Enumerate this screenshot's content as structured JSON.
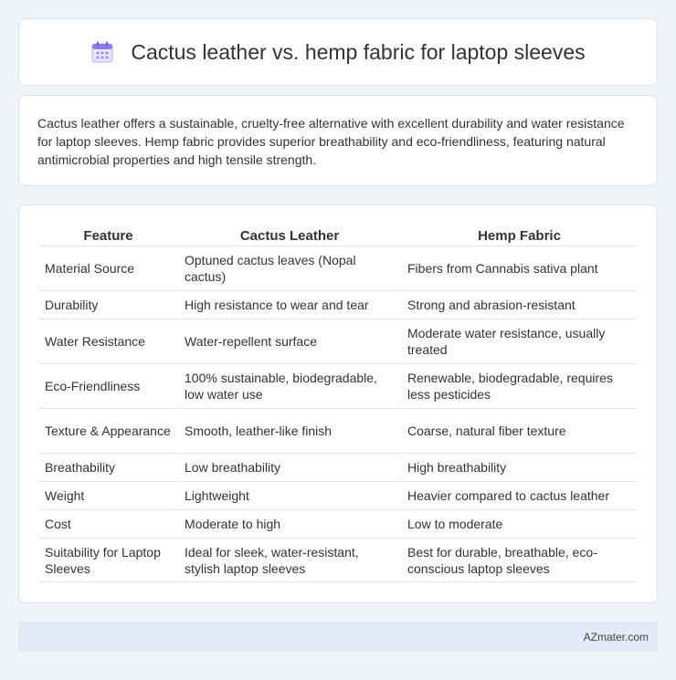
{
  "header": {
    "title": "Cactus leather vs. hemp fabric for laptop sleeves",
    "icon": "calendar-icon"
  },
  "summary": {
    "text": "Cactus leather offers a sustainable, cruelty-free alternative with excellent durability and water resistance for laptop sleeves. Hemp fabric provides superior breathability and eco-friendliness, featuring natural antimicrobial properties and high tensile strength."
  },
  "table": {
    "headers": [
      "Feature",
      "Cactus Leather",
      "Hemp Fabric"
    ],
    "rows": [
      [
        "Material Source",
        "Optuned cactus leaves (Nopal cactus)",
        "Fibers from Cannabis sativa plant"
      ],
      [
        "Durability",
        "High resistance to wear and tear",
        "Strong and abrasion-resistant"
      ],
      [
        "Water Resistance",
        "Water-repellent surface",
        "Moderate water resistance, usually treated"
      ],
      [
        "Eco-Friendliness",
        "100% sustainable, biodegradable, low water use",
        "Renewable, biodegradable, requires less pesticides"
      ],
      [
        "Texture & Appearance",
        "Smooth, leather-like finish",
        "Coarse, natural fiber texture"
      ],
      [
        "Breathability",
        "Low breathability",
        "High breathability"
      ],
      [
        "Weight",
        "Lightweight",
        "Heavier compared to cactus leather"
      ],
      [
        "Cost",
        "Moderate to high",
        "Low to moderate"
      ],
      [
        "Suitability for Laptop Sleeves",
        "Ideal for sleek, water-resistant, stylish laptop sleeves",
        "Best for durable, breathable, eco-conscious laptop sleeves"
      ]
    ]
  },
  "footer": {
    "brand": "AZmater.com"
  }
}
